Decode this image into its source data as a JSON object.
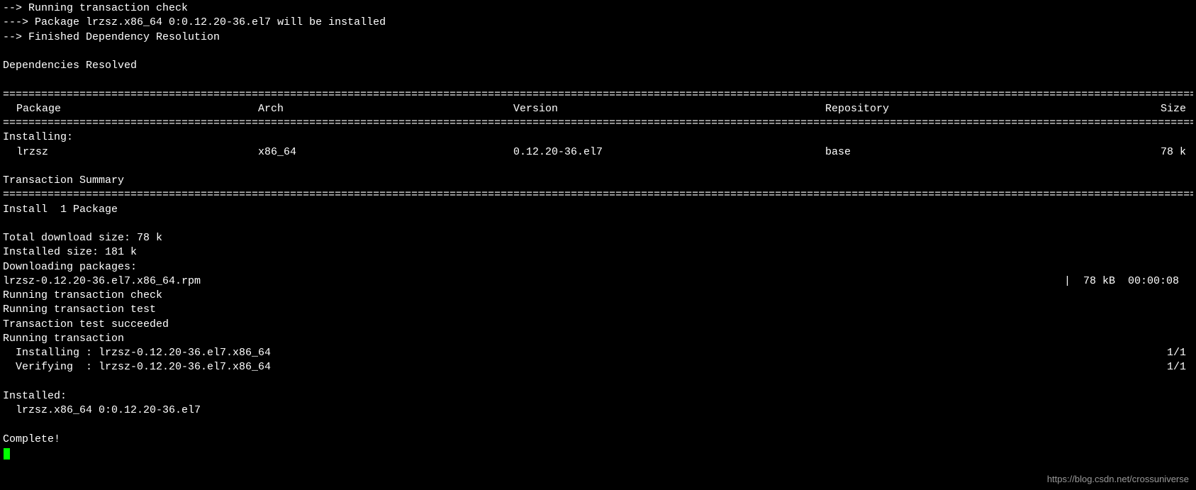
{
  "pre_lines": [
    "--> Running transaction check",
    "---> Package lrzsz.x86_64 0:0.12.20-36.el7 will be installed",
    "--> Finished Dependency Resolution",
    "",
    "Dependencies Resolved",
    ""
  ],
  "hr": "================================================================================================================================================================================================",
  "table": {
    "headers": {
      "pkg": " Package",
      "arch": "Arch",
      "ver": "Version",
      "repo": "Repository",
      "size": "Size"
    },
    "section": "Installing:",
    "row": {
      "pkg": " lrzsz",
      "arch": "x86_64",
      "ver": "0.12.20-36.el7",
      "repo": "base",
      "size": "78 k"
    }
  },
  "summary_title": "Transaction Summary",
  "summary_line": "Install  1 Package",
  "post_lines1": [
    "",
    "Total download size: 78 k",
    "Installed size: 181 k",
    "Downloading packages:"
  ],
  "download": {
    "file": "lrzsz-0.12.20-36.el7.x86_64.rpm",
    "status": "|  78 kB  00:00:08"
  },
  "post_lines2": [
    "Running transaction check",
    "Running transaction test",
    "Transaction test succeeded",
    "Running transaction"
  ],
  "progress": [
    {
      "left": "  Installing : lrzsz-0.12.20-36.el7.x86_64",
      "right": "1/1"
    },
    {
      "left": "  Verifying  : lrzsz-0.12.20-36.el7.x86_64",
      "right": "1/1"
    }
  ],
  "post_lines3": [
    "",
    "Installed:",
    "  lrzsz.x86_64 0:0.12.20-36.el7",
    "",
    "Complete!"
  ],
  "watermark": "https://blog.csdn.net/crossuniverse"
}
